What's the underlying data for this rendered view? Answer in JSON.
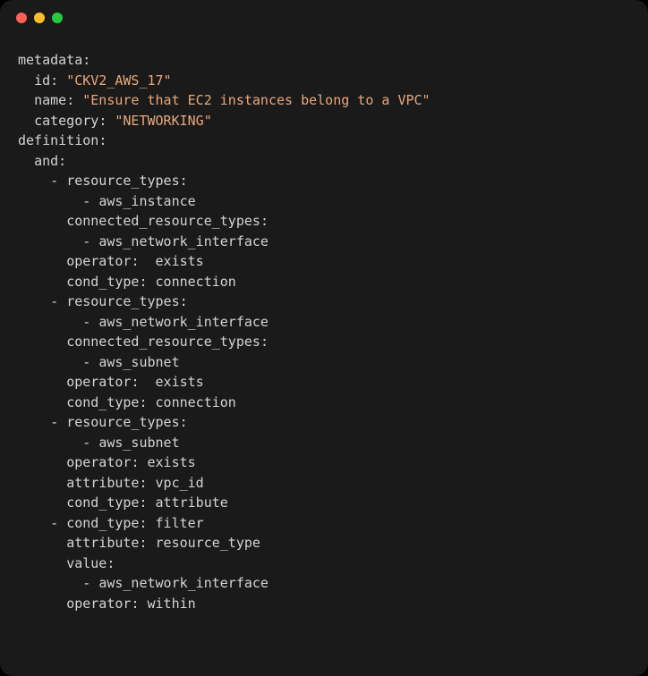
{
  "code": {
    "metadata_key": "metadata",
    "id_key": "id",
    "id_val": "\"CKV2_AWS_17\"",
    "name_key": "name",
    "name_val": "\"Ensure that EC2 instances belong to a VPC\"",
    "category_key": "category",
    "category_val": "\"NETWORKING\"",
    "definition_key": "definition",
    "and_key": "and",
    "resource_types_key": "resource_types",
    "connected_resource_types_key": "connected_resource_types",
    "operator_key": "operator",
    "cond_type_key": "cond_type",
    "attribute_key": "attribute",
    "value_key": "value",
    "aws_instance": "aws_instance",
    "aws_network_interface": "aws_network_interface",
    "aws_subnet": "aws_subnet",
    "exists": "exists",
    "exists_spaced": " exists",
    "connection": "connection",
    "vpc_id": "vpc_id",
    "attribute_val": "attribute",
    "filter": "filter",
    "resource_type": "resource_type",
    "within": "within",
    "colon": ":",
    "dash": "-"
  }
}
